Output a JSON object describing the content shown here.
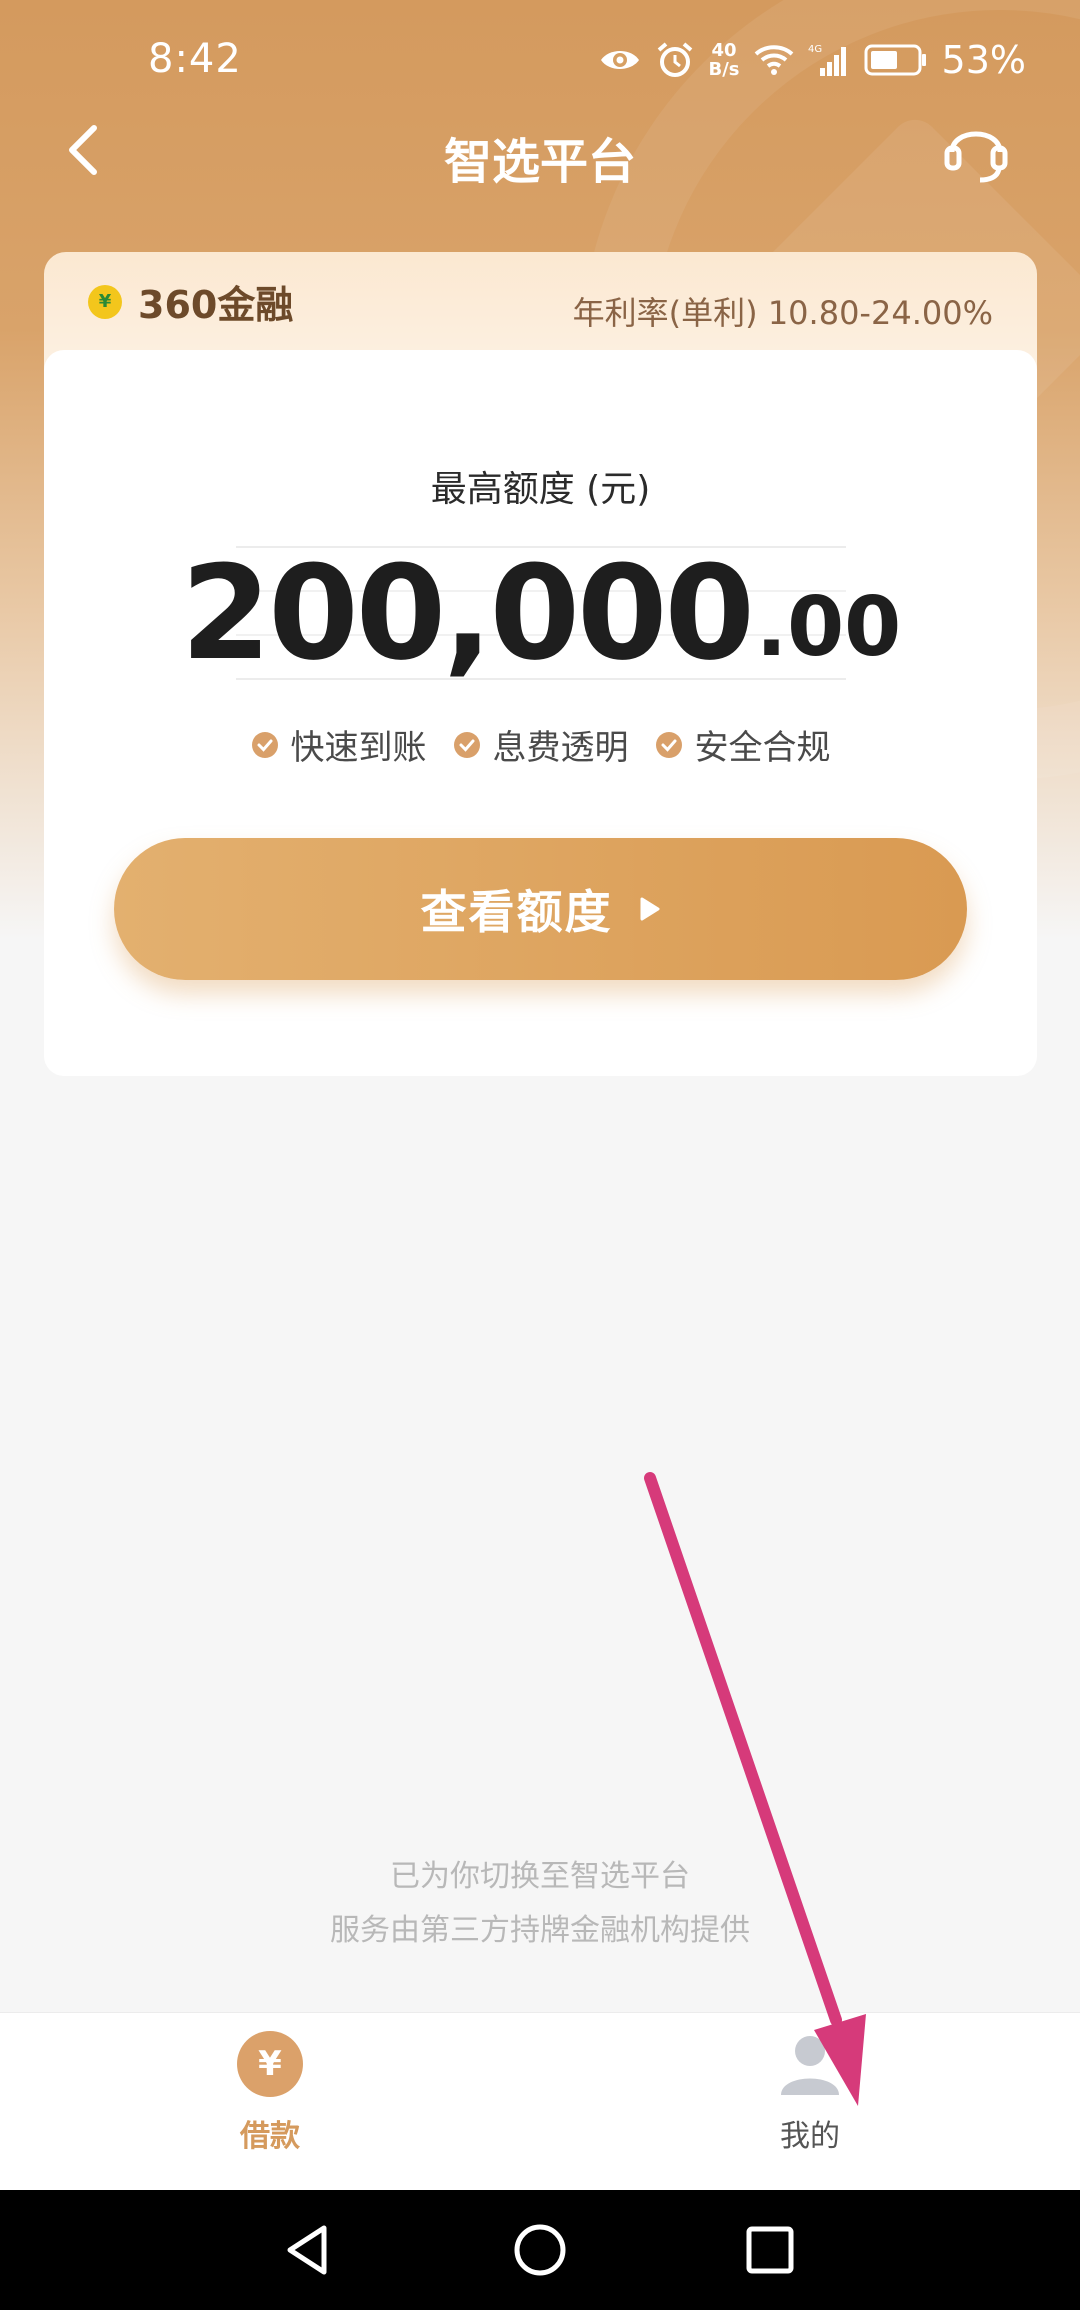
{
  "status_bar": {
    "time": "8:42",
    "net_speed_value": "40",
    "net_speed_unit": "B/s",
    "network_type": "4G",
    "battery": "53%"
  },
  "nav": {
    "title": "智选平台"
  },
  "product": {
    "brand_name": "360金融",
    "rate_text": "年利率(单利) 10.80-24.00%",
    "limit_label": "最高额度 (元)",
    "amount_integer": "200,000",
    "amount_decimal": ".00",
    "features": [
      "快速到账",
      "息费透明",
      "安全合规"
    ],
    "cta_label": "查看额度"
  },
  "notice": {
    "line1": "已为你切换至智选平台",
    "line2": "服务由第三方持牌金融机构提供"
  },
  "tabs": [
    {
      "label": "借款",
      "icon": "yuan-icon",
      "active": true
    },
    {
      "label": "我的",
      "icon": "user-icon",
      "active": false
    }
  ],
  "colors": {
    "accent": "#d99a52",
    "annotation": "#d63a7a"
  }
}
